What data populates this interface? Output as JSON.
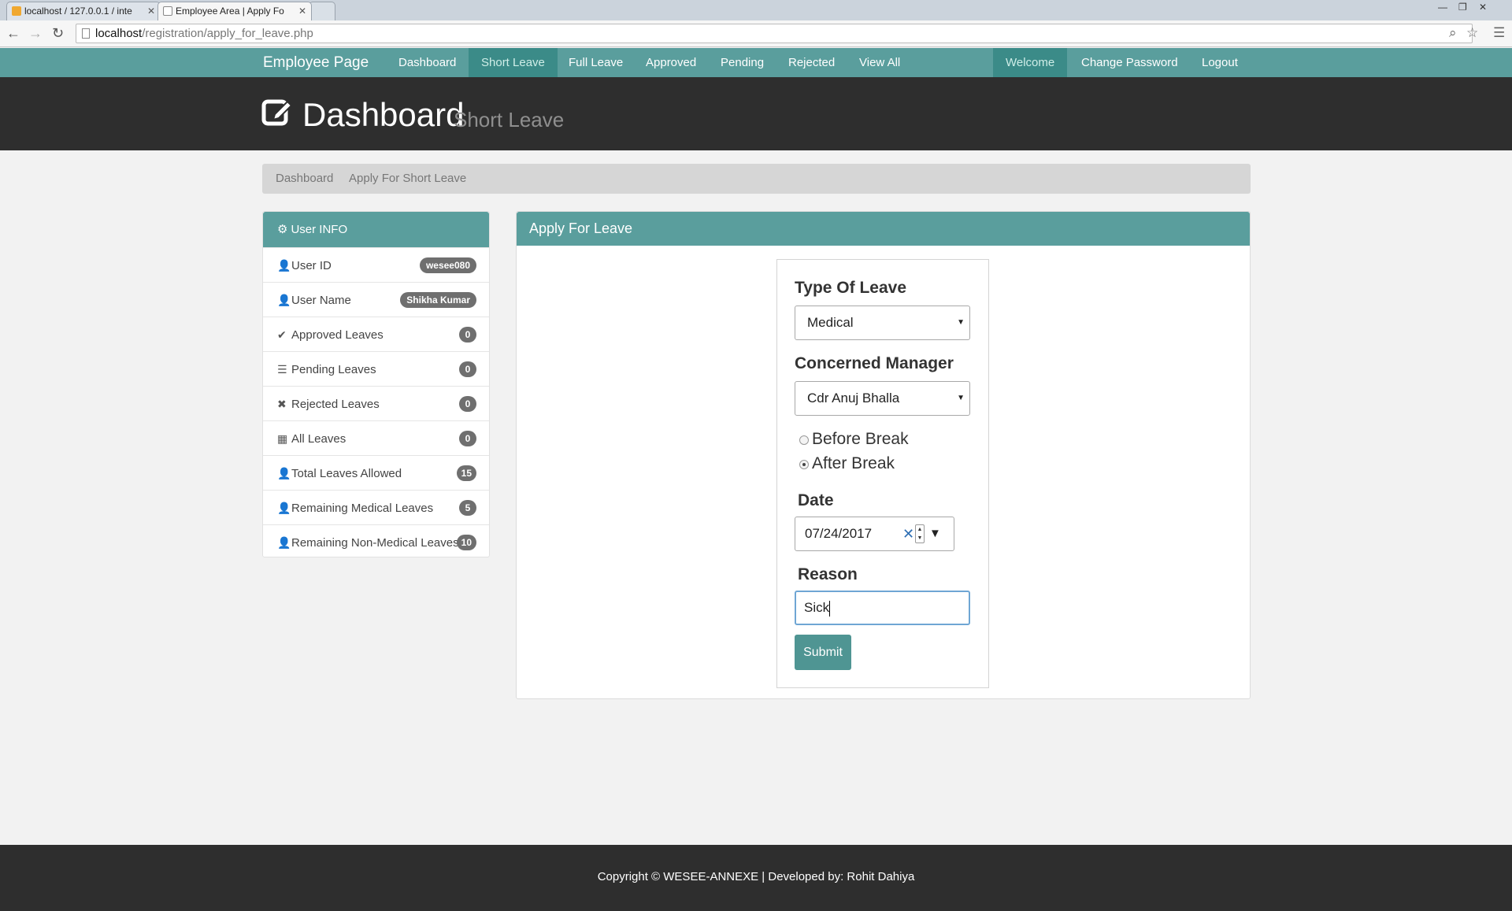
{
  "browser": {
    "tabs": [
      {
        "title": "localhost / 127.0.0.1 / inte",
        "icon": "phpmyadmin-icon"
      },
      {
        "title": "Employee Area | Apply Fo",
        "icon": "page-icon"
      }
    ],
    "url_host": "localhost",
    "url_path": "/registration/apply_for_leave.php"
  },
  "navbar": {
    "brand": "Employee Page",
    "items": [
      "Dashboard",
      "Short Leave",
      "Full Leave",
      "Approved",
      "Pending",
      "Rejected",
      "View All"
    ],
    "active_item": "Short Leave",
    "right_items": [
      "Welcome",
      "Change Password",
      "Logout"
    ]
  },
  "header": {
    "title": "Dashboard",
    "subtitle": "Short Leave",
    "icon": "edit-icon"
  },
  "breadcrumb": [
    "Dashboard",
    "Apply For Short Leave"
  ],
  "sidebar": {
    "title": "User INFO",
    "rows": [
      {
        "icon": "user-icon",
        "label": "User ID",
        "value": "wesee080"
      },
      {
        "icon": "user-icon",
        "label": "User Name",
        "value": "Shikha Kumar"
      },
      {
        "icon": "check-icon",
        "label": "Approved Leaves",
        "value": "0"
      },
      {
        "icon": "list-icon",
        "label": "Pending Leaves",
        "value": "0"
      },
      {
        "icon": "cross-icon",
        "label": "Rejected Leaves",
        "value": "0"
      },
      {
        "icon": "grid-icon",
        "label": "All Leaves",
        "value": "0"
      },
      {
        "icon": "user-icon",
        "label": "Total Leaves Allowed",
        "value": "15"
      },
      {
        "icon": "user-icon",
        "label": "Remaining Medical Leaves",
        "value": "5"
      },
      {
        "icon": "user-icon",
        "label": "Remaining Non-Medical Leaves",
        "value": "10"
      }
    ]
  },
  "form": {
    "panel_title": "Apply For Leave",
    "type_label": "Type Of Leave",
    "type_value": "Medical",
    "manager_label": "Concerned Manager",
    "manager_value": "Cdr Anuj Bhalla",
    "radio_before": "Before Break",
    "radio_after": "After Break",
    "radio_selected": "After Break",
    "date_label": "Date",
    "date_value": "07/24/2017",
    "reason_label": "Reason",
    "reason_value": "Sick",
    "submit_label": "Submit"
  },
  "footer": {
    "text": "Copyright © WESEE-ANNEXE | Developed by: Rohit Dahiya"
  },
  "colors": {
    "navbar": "#5a9e9d",
    "navbar_active": "#3b8b88",
    "header_bg": "#2e2e2e",
    "badge": "#6f6f6f"
  }
}
